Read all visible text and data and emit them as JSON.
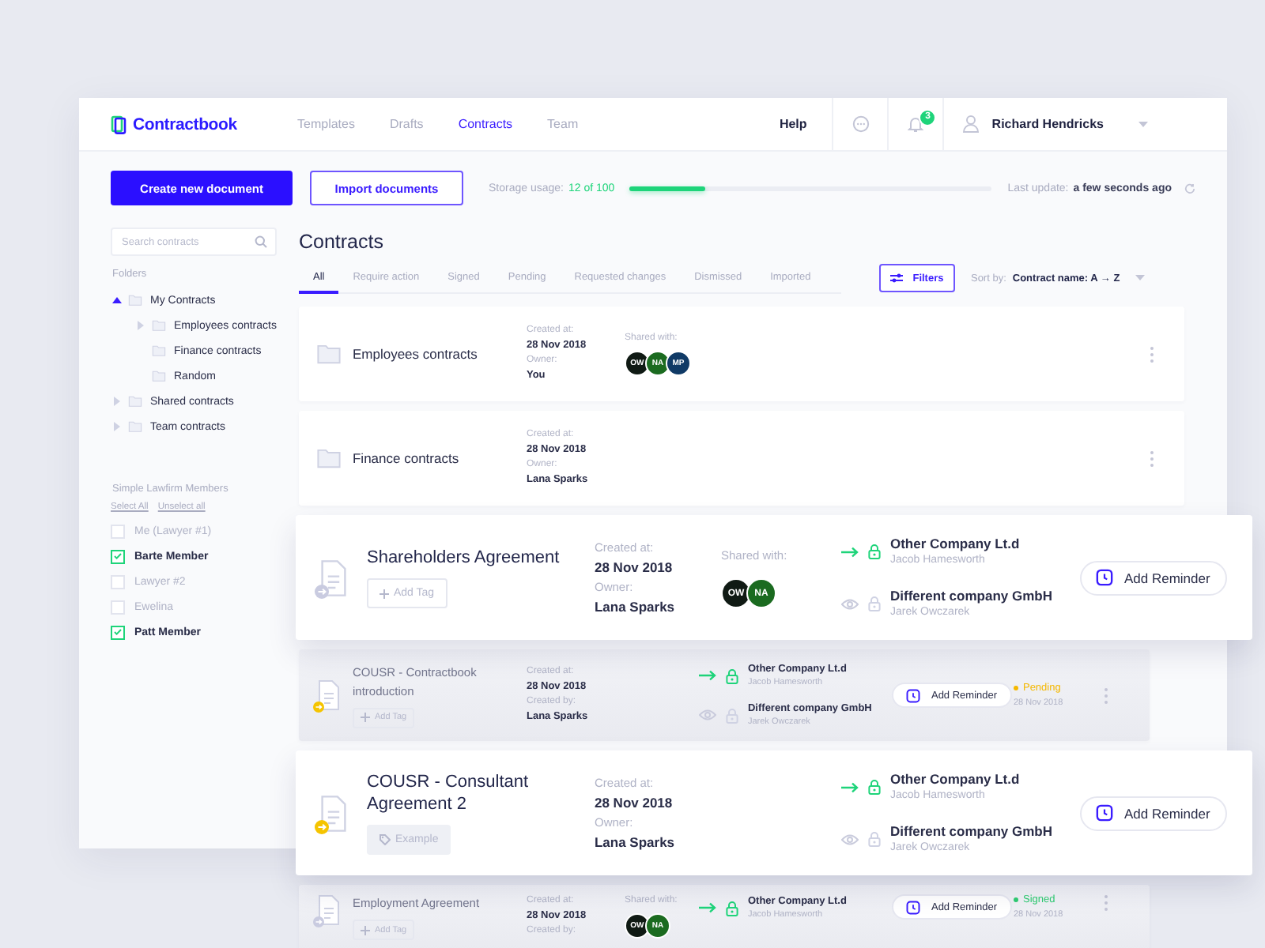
{
  "header": {
    "logo": "Contractbook",
    "nav": [
      {
        "label": "Templates",
        "selected": false
      },
      {
        "label": "Drafts",
        "selected": false
      },
      {
        "label": "Contracts",
        "selected": true
      },
      {
        "label": "Team",
        "selected": false
      }
    ],
    "help": "Help",
    "notification_count": "3",
    "user_name": "Richard Hendricks"
  },
  "toolbar": {
    "create_button": "Create new document",
    "import_button": "Import documents",
    "storage_label": "Storage usage:",
    "storage_value": "12 of 100",
    "storage": {
      "level": 0.21
    },
    "update_label": "Last update:",
    "update_value": "a few seconds ago"
  },
  "sidebar": {
    "search": {
      "placeholder": "Search contracts"
    },
    "folders_heading": "Folders",
    "folders": [
      {
        "label": "My Contracts",
        "expanded": true,
        "children": [
          {
            "label": "Employees contracts",
            "expanded": false
          },
          {
            "label": "Finance contracts"
          },
          {
            "label": "Random"
          }
        ]
      },
      {
        "label": "Shared contracts",
        "expanded": false
      },
      {
        "label": "Team contracts",
        "expanded": false
      }
    ],
    "members_heading": "Simple Lawfirm Members",
    "select_all": "Select All",
    "unselect_all": "Unselect all",
    "members": [
      {
        "name": "Me (Lawyer #1)",
        "checked": false
      },
      {
        "name": "Barte Member",
        "checked": true
      },
      {
        "name": "Lawyer #2",
        "checked": false
      },
      {
        "name": "Ewelina",
        "checked": false
      },
      {
        "name": "Patt Member",
        "checked": true
      }
    ]
  },
  "main": {
    "title": "Contracts",
    "tabs": [
      {
        "label": "All",
        "selected": true
      },
      {
        "label": "Require action",
        "selected": false
      },
      {
        "label": "Signed",
        "selected": false
      },
      {
        "label": "Pending",
        "selected": false
      },
      {
        "label": "Requested changes",
        "selected": false
      },
      {
        "label": "Dismissed",
        "selected": false
      },
      {
        "label": "Imported",
        "selected": false
      }
    ],
    "filters_button": "Filters",
    "sort_label": "Sort by:",
    "sort_value": "Contract name: A → Z"
  },
  "rows": [
    {
      "kind": "folder",
      "title": "Employees contracts",
      "created_label": "Created at:",
      "created": "28 Nov 2018",
      "owner_label": "Owner:",
      "owner": "You",
      "shared_label": "Shared with:",
      "avatars": [
        {
          "initials": "OW",
          "color": "#101a14"
        },
        {
          "initials": "NA",
          "color": "#1b6b20"
        },
        {
          "initials": "MP",
          "color": "#103a66"
        }
      ]
    },
    {
      "kind": "folder",
      "title": "Finance contracts",
      "created_label": "Created at:",
      "created": "28 Nov 2018",
      "owner_label": "Owner:",
      "owner": "Lana Sparks"
    },
    {
      "kind": "contract",
      "elevated": true,
      "title": "Shareholders Agreement",
      "badge": {
        "color": "#c9cbe0"
      },
      "tag": {
        "kind": "add",
        "label": "Add Tag"
      },
      "created_label": "Created at:",
      "created": "28 Nov 2018",
      "owner_label": "Owner:",
      "owner": "Lana Sparks",
      "shared_label": "Shared with:",
      "avatars": [
        {
          "initials": "OW",
          "color": "#101a14"
        },
        {
          "initials": "NA",
          "color": "#1b6b20"
        }
      ],
      "parties": [
        {
          "kind": "signer",
          "name": "Other Company Lt.d",
          "person": "Jacob Hamesworth"
        },
        {
          "kind": "viewer",
          "name": "Different company GmbH",
          "person": "Jarek Owczarek"
        }
      ],
      "reminder": "Add Reminder"
    },
    {
      "kind": "contract",
      "elevated": false,
      "title": "COUSR - Contractbook introduction",
      "badge": {
        "color": "#f5c400"
      },
      "tag": {
        "kind": "add",
        "label": "Add Tag"
      },
      "created_label": "Created at:",
      "created": "28 Nov 2018",
      "owner_label": "Created by:",
      "owner": "Lana Sparks",
      "parties": [
        {
          "kind": "signer",
          "name": "Other Company Lt.d",
          "person": "Jacob Hamesworth"
        },
        {
          "kind": "viewer",
          "name": "Different company GmbH",
          "person": "Jarek Owczarek"
        }
      ],
      "reminder": "Add Reminder",
      "status": {
        "label": "Pending",
        "color": "#f5b800",
        "date": "28 Nov 2018"
      }
    },
    {
      "kind": "contract",
      "elevated": true,
      "title": "COUSR - Consultant Agreement 2",
      "badge": {
        "color": "#f5c400"
      },
      "tag": {
        "kind": "label",
        "label": "Example"
      },
      "created_label": "Created at:",
      "created": "28 Nov 2018",
      "owner_label": "Owner:",
      "owner": "Lana Sparks",
      "parties": [
        {
          "kind": "signer",
          "name": "Other Company Lt.d",
          "person": "Jacob Hamesworth"
        },
        {
          "kind": "viewer",
          "name": "Different company GmbH",
          "person": "Jarek Owczarek"
        }
      ],
      "reminder": "Add Reminder"
    },
    {
      "kind": "contract",
      "elevated": false,
      "title": "Employment Agreement",
      "badge": {
        "color": "#c9cbe0"
      },
      "tag": {
        "kind": "add",
        "label": "Add Tag"
      },
      "created_label": "Created at:",
      "created": "28 Nov 2018",
      "owner_label": "Created by:",
      "shared_label": "Shared with:",
      "avatars": [
        {
          "initials": "OW",
          "color": "#101a14"
        },
        {
          "initials": "NA",
          "color": "#1b6b20"
        }
      ],
      "parties": [
        {
          "kind": "signer",
          "name": "Other Company Lt.d",
          "person": "Jacob Hamesworth"
        }
      ],
      "reminder": "Add Reminder",
      "status": {
        "label": "Signed",
        "color": "#2ecc71",
        "date": "28 Nov 2018"
      }
    }
  ]
}
